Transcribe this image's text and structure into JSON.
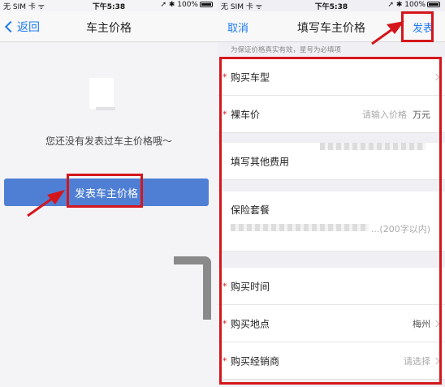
{
  "left": {
    "status": {
      "carrier": "无 SIM 卡 ᯤ",
      "time": "下午5:38",
      "battery": "➚ ✱ 100%"
    },
    "nav": {
      "back_label": "返回",
      "title": "车主价格"
    },
    "empty_message": "您还没有发表过车主价格哦～",
    "publish_button": "发表车主价格"
  },
  "right": {
    "status": {
      "carrier": "无 SIM 卡 ᯤ",
      "time": "下午5:38",
      "battery": "➚ ✱ 100%"
    },
    "nav": {
      "cancel_label": "取消",
      "title": "填写车主价格",
      "post_label": "发表"
    },
    "notice": "为保证价格真实有效，星号为必填项",
    "rows": {
      "car_model": {
        "label": "购买车型"
      },
      "bare_price": {
        "label": "裸车价",
        "placeholder": "请输入价格",
        "unit": "万元"
      },
      "other_fees": {
        "label": "填写其他费用"
      },
      "insurance": {
        "label": "保险套餐"
      },
      "remarks": {
        "placeholder": "...(200字以内)"
      },
      "purchase_time": {
        "label": "购买时间"
      },
      "location": {
        "label": "购买地点",
        "value": "梅州"
      },
      "dealer": {
        "label": "购买经销商",
        "placeholder": "请选择"
      }
    },
    "required_mark": "*"
  },
  "colors": {
    "accent": "#1e7cf2",
    "button": "#4f7fd4",
    "highlight": "#d4161c"
  }
}
